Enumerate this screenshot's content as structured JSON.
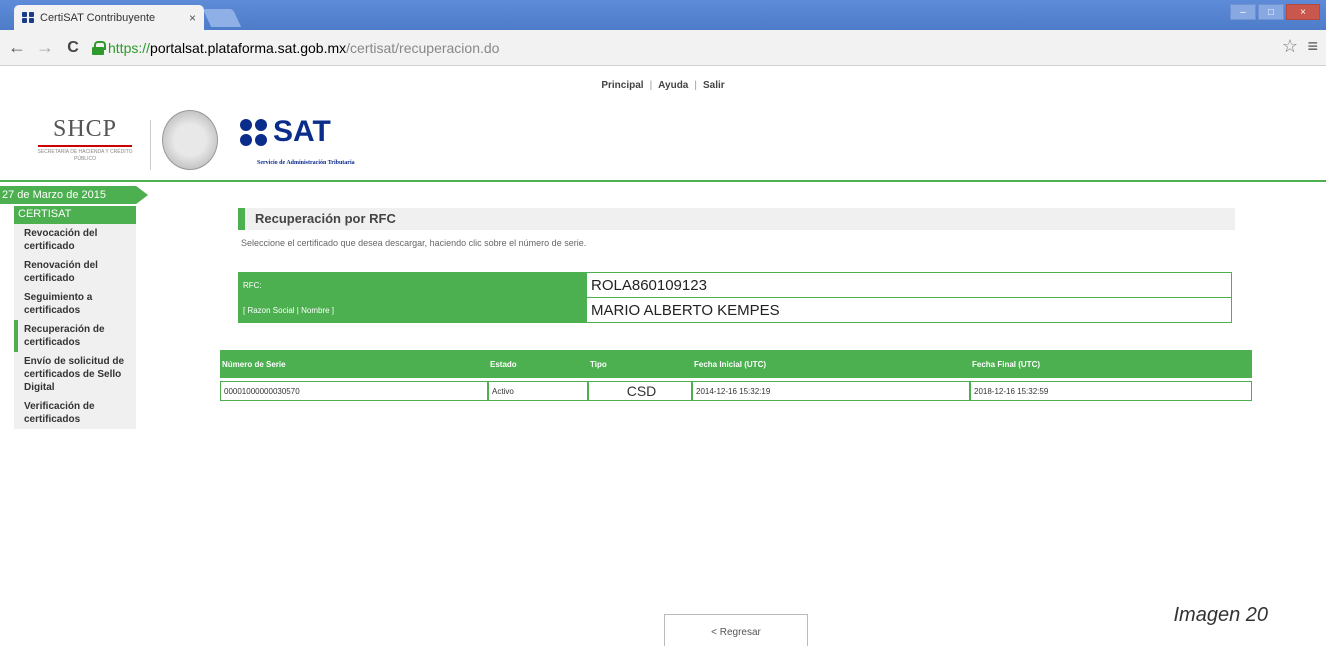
{
  "browser": {
    "tab_title": "CertiSAT Contribuyente",
    "tab_close": "×",
    "url_scheme": "https://",
    "url_host": "portalsat.plataforma.sat.gob.mx",
    "url_path": "/certisat/recuperacion.do",
    "back_glyph": "←",
    "forward_glyph": "→",
    "reload_glyph": "C",
    "star_glyph": "☆",
    "menu_glyph": "≡",
    "win_min": "–",
    "win_max": "□",
    "win_close": "×"
  },
  "topnav": {
    "items": [
      "Principal",
      "Ayuda",
      "Salir"
    ],
    "separator": "|"
  },
  "header": {
    "shcp": "SHCP",
    "shcp_sub": "SECRETARÍA DE HACIENDA Y CRÉDITO PÚBLICO",
    "sat": "SAT",
    "sat_sub": "Servicio de Administración Tributaria"
  },
  "sidebar": {
    "date": "27 de Marzo de 2015",
    "heading": "CERTISAT",
    "items": [
      {
        "label": "Revocación del certificado"
      },
      {
        "label": "Renovación del certificado"
      },
      {
        "label": "Seguimiento a certificados"
      },
      {
        "label": "Recuperación de certificados"
      },
      {
        "label": "Envío de solicitud de certificados de Sello Digital"
      },
      {
        "label": "Verificación de certificados"
      }
    ]
  },
  "content": {
    "title": "Recuperación por RFC",
    "instructions": "Seleccione el certificado que desea descargar, haciendo clic sobre el número de serie.",
    "rfc_label": "RFC:",
    "rfc_value": "ROLA860109123",
    "name_label": "[ Razon Social | Nombre ]",
    "name_value": "MARIO ALBERTO KEMPES"
  },
  "cert_table": {
    "headers": [
      "Número de Serie",
      "Estado",
      "Tipo",
      "Fecha Inicial (UTC)",
      "Fecha Final (UTC)"
    ],
    "rows": [
      [
        "00001000000030570",
        "Activo",
        "CSD",
        "2014-12-16 15:32:19",
        "2018-12-16 15:32:59"
      ]
    ]
  },
  "back_button": "< Regresar",
  "caption": "Imagen 20",
  "colors": {
    "accent": "#4caf50",
    "sat_blue": "#0a2c8a"
  }
}
